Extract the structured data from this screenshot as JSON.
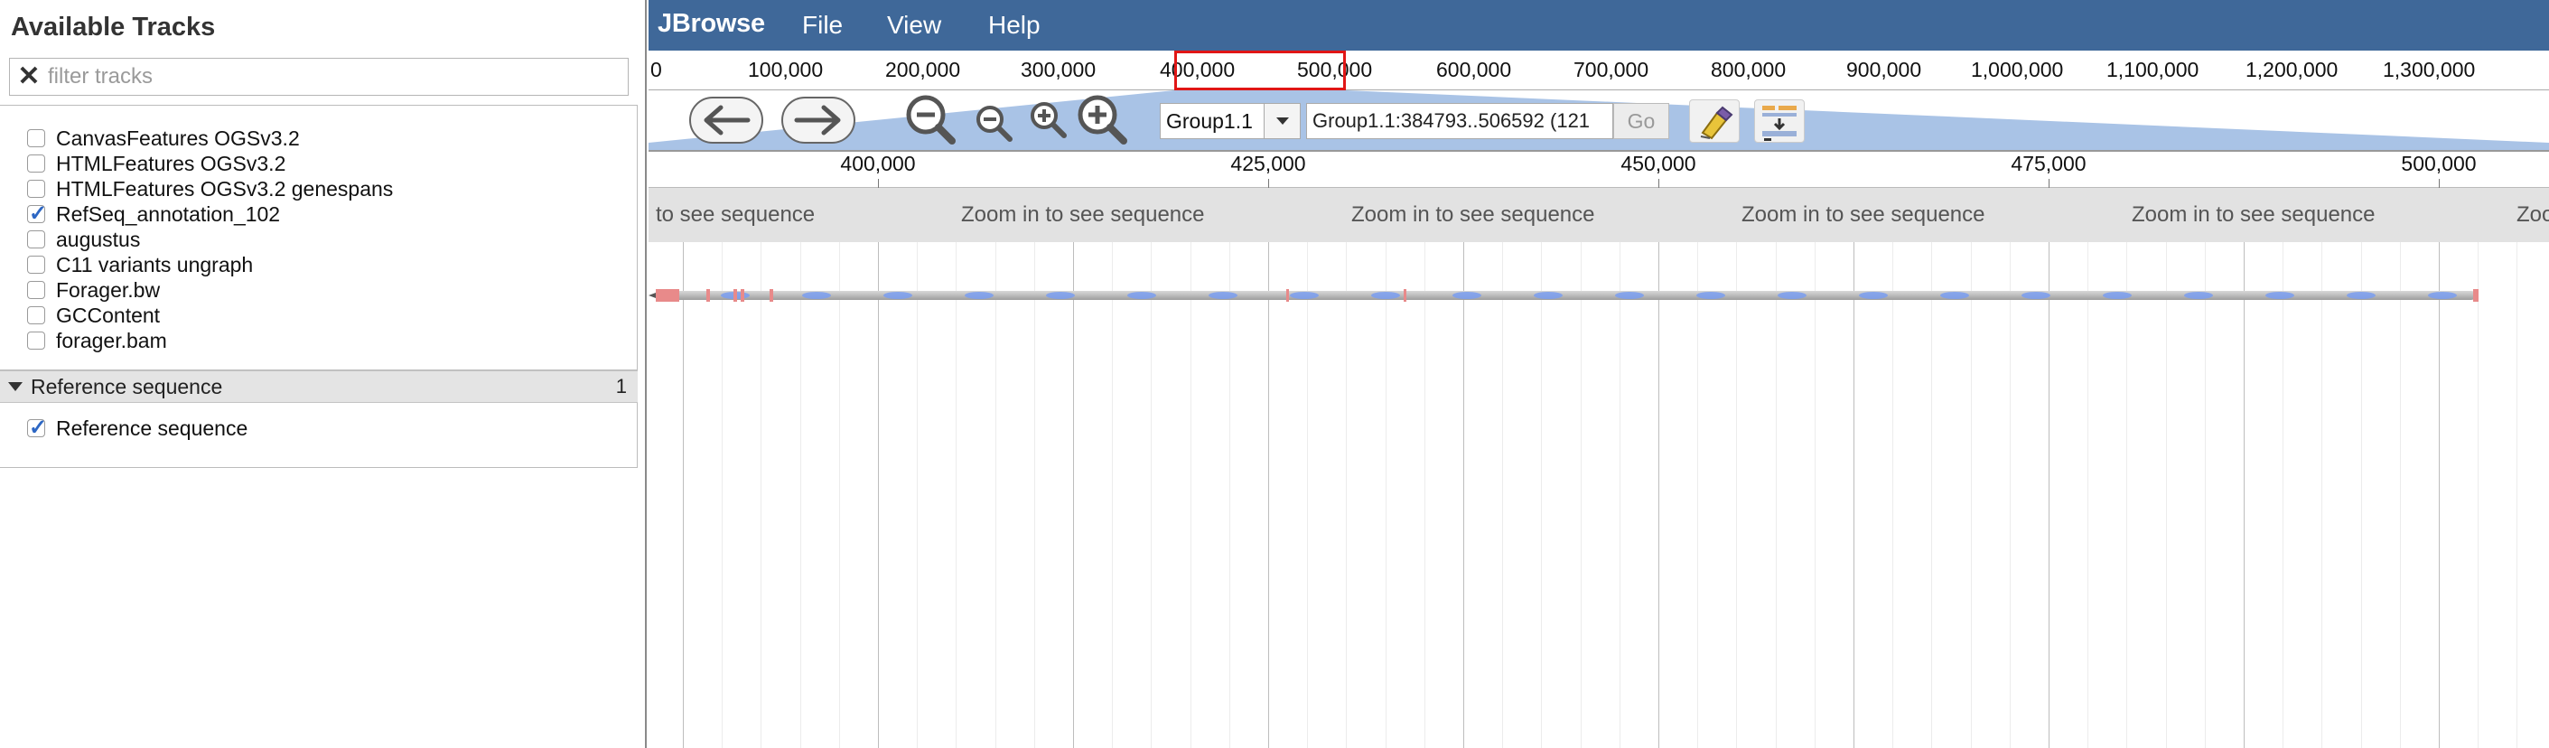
{
  "sidebar": {
    "title": "Available Tracks",
    "filter_placeholder": "filter tracks",
    "tracks": [
      {
        "label": "CanvasFeatures OGSv3.2",
        "checked": false
      },
      {
        "label": "HTMLFeatures OGSv3.2",
        "checked": false
      },
      {
        "label": "HTMLFeatures OGSv3.2 genespans",
        "checked": false
      },
      {
        "label": "RefSeq_annotation_102",
        "checked": true
      },
      {
        "label": "augustus",
        "checked": false
      },
      {
        "label": "C11 variants ungraph",
        "checked": false
      },
      {
        "label": "Forager.bw",
        "checked": false
      },
      {
        "label": "GCContent",
        "checked": false
      },
      {
        "label": "forager.bam",
        "checked": false
      }
    ],
    "category": {
      "label": "Reference sequence",
      "count": "1"
    },
    "category_tracks": [
      {
        "label": "Reference sequence",
        "checked": true
      }
    ]
  },
  "menubar": {
    "brand": "JBrowse",
    "items": [
      "File",
      "View",
      "Help"
    ]
  },
  "overview": {
    "labels": [
      "0",
      "100,000",
      "200,000",
      "300,000",
      "400,000",
      "500,000",
      "600,000",
      "700,000",
      "800,000",
      "900,000",
      "1,000,000",
      "1,100,000",
      "1,200,000",
      "1,300,000"
    ]
  },
  "navigation": {
    "refseq_selected": "Group1.1",
    "location": "Group1.1:384793..506592 (121",
    "go_label": "Go",
    "icons": [
      "pan-left-icon",
      "pan-right-icon",
      "zoom-out-large-icon",
      "zoom-out-small-icon",
      "zoom-in-small-icon",
      "zoom-in-large-icon",
      "highlight-marker-icon",
      "tracklist-toggle-icon"
    ]
  },
  "ruler": {
    "labels": [
      "400,000",
      "425,000",
      "450,000",
      "475,000",
      "500,000"
    ]
  },
  "sequence_track": {
    "labels": [
      "to see sequence",
      "Zoom in to see sequence",
      "Zoom in to see sequence",
      "Zoom in to see sequence",
      "Zoom in to see sequence",
      "Zoo"
    ]
  },
  "colors": {
    "menubar": "#3f6899",
    "exon": "#e88a8a",
    "intron_arrow": "#7a9df0",
    "zoom_fan": "#a9c3e6",
    "highlight": "#e01616"
  }
}
